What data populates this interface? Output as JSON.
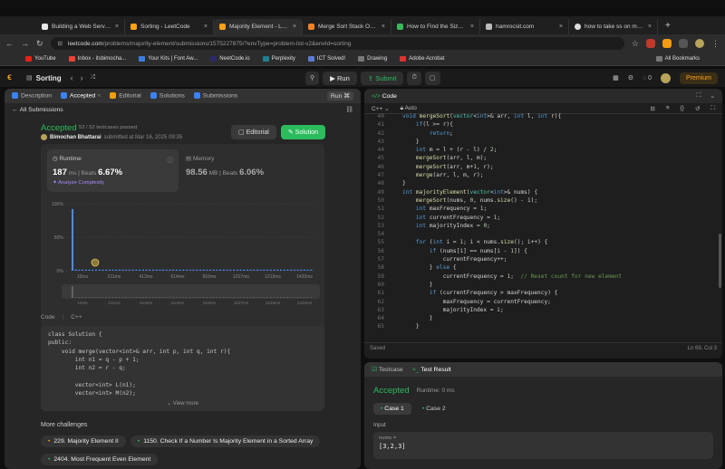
{
  "browser": {
    "tabs": [
      {
        "title": "Building a Web Server wi"
      },
      {
        "title": "Sorting - LeetCode"
      },
      {
        "title": "Majority Element - LeetC"
      },
      {
        "title": "Merge Sort Stack Overflo"
      },
      {
        "title": "How to Find the Size of a"
      },
      {
        "title": "hamrocsit.com"
      },
      {
        "title": "how to take ss on mac? -"
      }
    ],
    "new_tab": "+",
    "url_domain": "leetcode.com",
    "url_path": "/problems/majority-element/submissions/1575227875/?envType=problem-list-v2&envId=sorting",
    "bookmarks": [
      "YouTube",
      "Inbox - itsbimocha...",
      "Your Kits | Font Aw...",
      "NeetCode.io",
      "Perplexity",
      "ICT Solved!",
      "Drawing",
      "Adobe Acrobat"
    ],
    "all_bookmarks": "All Bookmarks"
  },
  "header": {
    "problem_list": "Sorting",
    "run": "Run",
    "submit": "Submit",
    "fire_count": "0",
    "premium": "Premium"
  },
  "left": {
    "tabs": {
      "description": "Description",
      "accepted": "Accepted",
      "editorial": "Editorial",
      "solutions": "Solutions",
      "submissions": "Submissions",
      "run": "Run"
    },
    "all_submissions": "All Submissions",
    "status": "Accepted",
    "testcases": "52 / 52 testcases passed",
    "author": "Bimochan Bhattarai",
    "submitted": "submitted at Mar 16, 2025 09:35",
    "editorial_btn": "Editorial",
    "solution_btn": "Solution",
    "runtime": {
      "label": "Runtime",
      "value": "187",
      "unit": "ms",
      "beats_label": "Beats",
      "beats": "6.67%",
      "analyze": "Analyze Complexity"
    },
    "memory": {
      "label": "Memory",
      "value": "98.56",
      "unit": "MB",
      "beats_label": "Beats",
      "beats": "6.06%"
    },
    "code_label": "Code",
    "lang_label": "C++",
    "code_lines": [
      "class Solution {",
      "public:",
      "    void merge(vector<int>& arr, int p, int q, int r){",
      "        int n1 = q - p + 1;",
      "        int n2 = r - q;",
      "",
      "        vector<int> L(n1);",
      "        vector<int> M(n2);"
    ],
    "view_more": "View more",
    "more_challenges": "More challenges",
    "challenges": [
      "229. Majority Element II",
      "1150. Check If a Number Is Majority Element in a Sorted Array",
      "2404. Most Frequent Even Element"
    ]
  },
  "chart_data": {
    "type": "bar",
    "yticks": [
      "100%",
      "50%",
      "0%"
    ],
    "xticks": [
      "10ms",
      "211ms",
      "413ms",
      "614ms",
      "816ms",
      "1017ms",
      "1219ms",
      "1420ms"
    ],
    "ylim": [
      0,
      100
    ],
    "values": [
      92,
      2,
      1.5,
      1.5,
      1,
      1,
      1,
      1,
      1,
      1,
      1,
      1,
      1,
      1,
      1,
      1,
      1,
      1,
      1,
      1,
      1,
      1,
      1,
      1,
      1,
      1,
      1,
      1,
      1,
      1,
      1,
      1,
      1,
      1,
      1,
      1,
      1,
      1,
      1,
      1,
      1,
      1,
      1,
      1,
      1,
      1,
      1,
      1,
      1,
      1,
      1,
      1,
      1,
      1,
      1,
      1,
      1,
      1,
      1,
      1,
      1,
      1,
      1,
      1,
      1,
      1,
      1,
      1,
      1,
      1,
      1,
      1
    ],
    "you_index": 7,
    "color": "#4a8af4"
  },
  "editor": {
    "tab": "Code",
    "lang": "C++",
    "auto": "Auto",
    "start_line": 40,
    "lines": [
      [
        [
          "kw",
          "void "
        ],
        [
          "fn",
          "mergeSort"
        ],
        [
          "pl",
          "("
        ],
        [
          "ty",
          "vector"
        ],
        [
          "pl",
          "<"
        ],
        [
          "kw",
          "int"
        ],
        [
          "pl",
          ">& arr, "
        ],
        [
          "kw",
          "int"
        ],
        [
          "pl",
          " l, "
        ],
        [
          "kw",
          "int"
        ],
        [
          "pl",
          " r){"
        ]
      ],
      [
        [
          "pl",
          "    "
        ],
        [
          "kw",
          "if"
        ],
        [
          "pl",
          "(l >= r){"
        ]
      ],
      [
        [
          "pl",
          "        "
        ],
        [
          "kw",
          "return"
        ],
        [
          "pl",
          ";"
        ]
      ],
      [
        [
          "pl",
          "    }"
        ]
      ],
      [
        [
          "pl",
          "    "
        ],
        [
          "kw",
          "int"
        ],
        [
          "pl",
          " m = l + (r - l) / "
        ],
        [
          "num",
          "2"
        ],
        [
          "pl",
          ";"
        ]
      ],
      [
        [
          "pl",
          "    "
        ],
        [
          "fn",
          "mergeSort"
        ],
        [
          "pl",
          "(arr, l, m);"
        ]
      ],
      [
        [
          "pl",
          "    "
        ],
        [
          "fn",
          "mergeSort"
        ],
        [
          "pl",
          "(arr, m+"
        ],
        [
          "num",
          "1"
        ],
        [
          "pl",
          ", r);"
        ]
      ],
      [
        [
          "pl",
          "    "
        ],
        [
          "fn",
          "merge"
        ],
        [
          "pl",
          "(arr, l, m, r);"
        ]
      ],
      [
        [
          "pl",
          "}"
        ]
      ],
      [
        [
          "kw",
          "int "
        ],
        [
          "fn",
          "majorityElement"
        ],
        [
          "pl",
          "("
        ],
        [
          "ty",
          "vector"
        ],
        [
          "pl",
          "<"
        ],
        [
          "kw",
          "int"
        ],
        [
          "pl",
          ">& nums) {"
        ]
      ],
      [
        [
          "pl",
          "    "
        ],
        [
          "fn",
          "mergeSort"
        ],
        [
          "pl",
          "(nums, "
        ],
        [
          "num",
          "0"
        ],
        [
          "pl",
          ", nums."
        ],
        [
          "fn",
          "size"
        ],
        [
          "pl",
          "() - "
        ],
        [
          "num",
          "1"
        ],
        [
          "pl",
          ");"
        ]
      ],
      [
        [
          "pl",
          "    "
        ],
        [
          "kw",
          "int"
        ],
        [
          "pl",
          " maxFrequency = "
        ],
        [
          "num",
          "1"
        ],
        [
          "pl",
          ";"
        ]
      ],
      [
        [
          "pl",
          "    "
        ],
        [
          "kw",
          "int"
        ],
        [
          "pl",
          " currentFrequency = "
        ],
        [
          "num",
          "1"
        ],
        [
          "pl",
          ";"
        ]
      ],
      [
        [
          "pl",
          "    "
        ],
        [
          "kw",
          "int"
        ],
        [
          "pl",
          " majorityIndex = "
        ],
        [
          "num",
          "0"
        ],
        [
          "pl",
          ";"
        ]
      ],
      [
        [
          "pl",
          ""
        ]
      ],
      [
        [
          "pl",
          "    "
        ],
        [
          "kw",
          "for"
        ],
        [
          "pl",
          " ("
        ],
        [
          "kw",
          "int"
        ],
        [
          "pl",
          " i = "
        ],
        [
          "num",
          "1"
        ],
        [
          "pl",
          "; i < nums."
        ],
        [
          "fn",
          "size"
        ],
        [
          "pl",
          "(); i++) {"
        ]
      ],
      [
        [
          "pl",
          "        "
        ],
        [
          "kw",
          "if"
        ],
        [
          "pl",
          " (nums[i] == nums[i - "
        ],
        [
          "num",
          "1"
        ],
        [
          "pl",
          "]) {"
        ]
      ],
      [
        [
          "pl",
          "            currentFrequency++;"
        ]
      ],
      [
        [
          "pl",
          "        } "
        ],
        [
          "kw",
          "else"
        ],
        [
          "pl",
          " {"
        ]
      ],
      [
        [
          "pl",
          "            currentFrequency = "
        ],
        [
          "num",
          "1"
        ],
        [
          "pl",
          ";  "
        ],
        [
          "cm",
          "// Reset count for new element"
        ]
      ],
      [
        [
          "pl",
          "        }"
        ]
      ],
      [
        [
          "pl",
          "        "
        ],
        [
          "kw",
          "if"
        ],
        [
          "pl",
          " (currentFrequency > maxFrequency) {"
        ]
      ],
      [
        [
          "pl",
          "            maxFrequency = currentFrequency;"
        ]
      ],
      [
        [
          "pl",
          "            majorityIndex = i;"
        ]
      ],
      [
        [
          "pl",
          "        }"
        ]
      ],
      [
        [
          "pl",
          "    }"
        ]
      ]
    ],
    "saved": "Saved",
    "cursor": "Ln 69, Col 3"
  },
  "result": {
    "tab_testcase": "Testcase",
    "tab_result": "Test Result",
    "status": "Accepted",
    "runtime": "Runtime: 0 ms",
    "case1": "Case 1",
    "case2": "Case 2",
    "input_label": "Input",
    "param": "nums =",
    "value": "[3,2,3]"
  }
}
